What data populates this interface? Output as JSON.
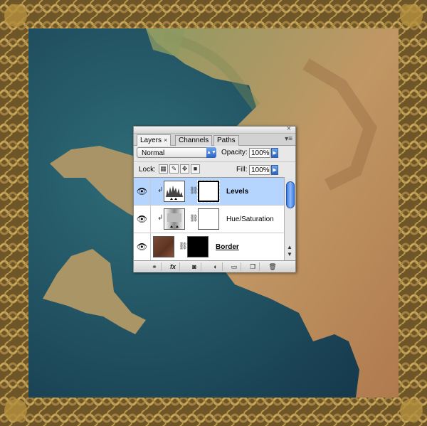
{
  "panel": {
    "tabs": [
      {
        "label": "Layers",
        "close": "×"
      },
      {
        "label": "Channels"
      },
      {
        "label": "Paths"
      }
    ],
    "blend_mode": "Normal",
    "opacity_label": "Opacity:",
    "opacity_value": "100%",
    "lock_label": "Lock:",
    "fill_label": "Fill:",
    "fill_value": "100%",
    "layers": [
      {
        "name": "Levels",
        "selected": true,
        "visible": true,
        "adjustment": "levels-icon",
        "mask": "white-with-border"
      },
      {
        "name": "Hue/Saturation",
        "selected": false,
        "visible": true,
        "adjustment": "hue-saturation-icon",
        "mask": "white"
      },
      {
        "name": "Border",
        "selected": false,
        "visible": true,
        "thumbnail": "brown-texture",
        "mask": "black"
      }
    ],
    "footer_icons": [
      "link-layers-icon",
      "fx-icon",
      "add-mask-icon",
      "adjustment-layer-icon",
      "group-folder-icon",
      "new-layer-icon",
      "trash-icon"
    ]
  },
  "colors": {
    "selection": "#b5d5fe",
    "ocean": "#1f4f63",
    "land": "#b4885a",
    "frame": "#8a6a35"
  }
}
